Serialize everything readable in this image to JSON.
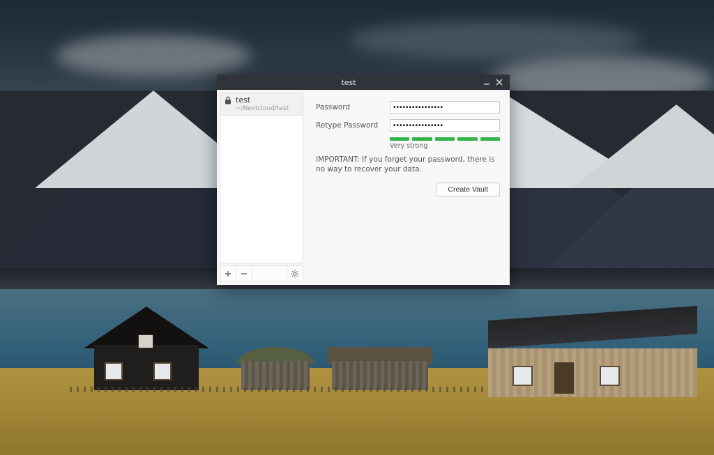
{
  "window": {
    "title": "test"
  },
  "sidebar": {
    "vaults": [
      {
        "name": "test",
        "path": "~/Nextcloud/test"
      }
    ]
  },
  "form": {
    "password_label": "Password",
    "retype_label": "Retype Password",
    "password_value": "••••••••••••••••",
    "retype_value": "••••••••••••••••",
    "strength_label": "Very strong",
    "strength_bars": 5,
    "warning_text": "IMPORTANT: If you forget your password, there is no way to recover your data.",
    "create_label": "Create Vault"
  }
}
